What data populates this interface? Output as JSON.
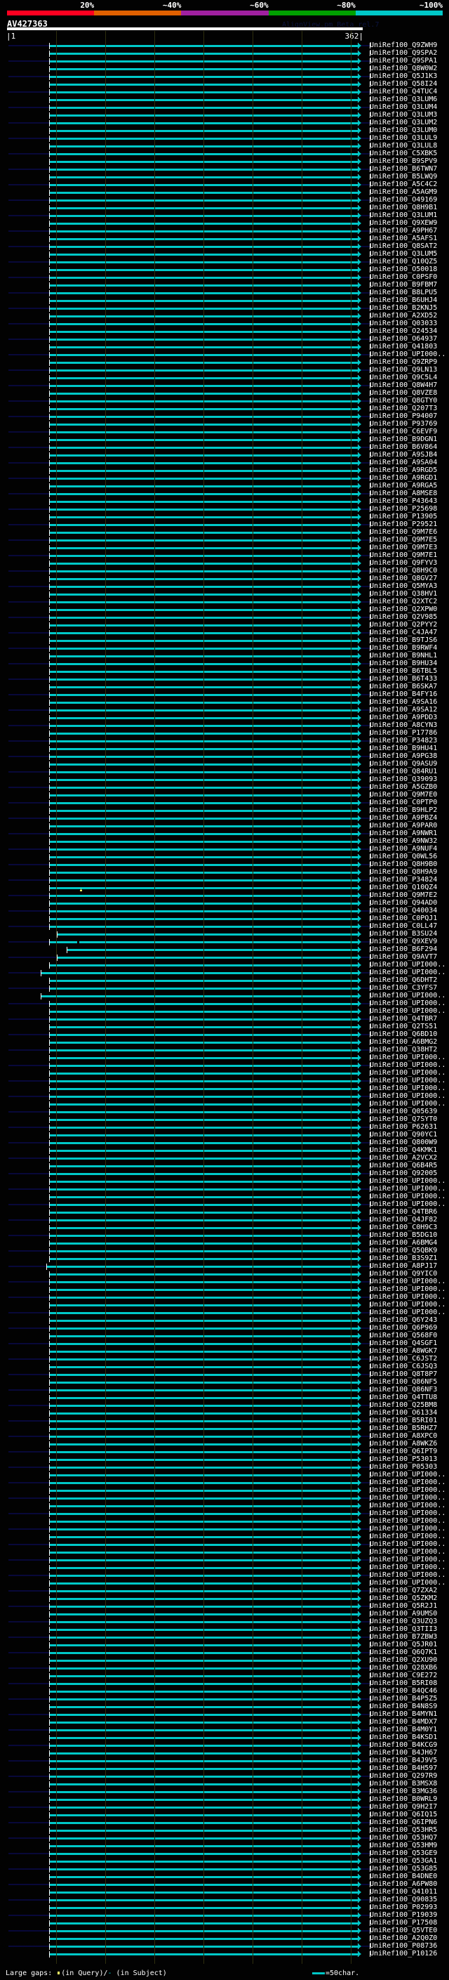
{
  "legend": {
    "percent_labels": [
      "20%",
      "~40%",
      "~60%",
      "~80%",
      "~100%"
    ],
    "colors": [
      "#ff0020",
      "#e06000",
      "#a020a0",
      "#00a000",
      "#00c8c8"
    ]
  },
  "header": {
    "title": "AV427363",
    "watermark": "AlignView.pm Beta rel.7"
  },
  "ruler": {
    "start_label": "|1",
    "end_label": "362|",
    "query_length": 362
  },
  "hit_color": "#00c8c8",
  "hits": [
    [
      "UniRef100_Q9ZWH9",
      43,
      357
    ],
    [
      "UniRef100_Q9SPA2",
      43,
      357
    ],
    [
      "UniRef100_Q9SPA1",
      43,
      357
    ],
    [
      "UniRef100_Q8W0W2",
      43,
      357
    ],
    [
      "UniRef100_Q5J1K3",
      43,
      357
    ],
    [
      "UniRef100_Q58I24",
      43,
      357
    ],
    [
      "UniRef100_Q4TUC4",
      43,
      357
    ],
    [
      "UniRef100_Q3LUM6",
      43,
      357
    ],
    [
      "UniRef100_Q3LUM4",
      43,
      357
    ],
    [
      "UniRef100_Q3LUM3",
      43,
      357
    ],
    [
      "UniRef100_Q3LUM2",
      43,
      357
    ],
    [
      "UniRef100_Q3LUM0",
      43,
      357
    ],
    [
      "UniRef100_Q3LUL9",
      43,
      357
    ],
    [
      "UniRef100_Q3LUL8",
      43,
      357
    ],
    [
      "UniRef100_C5XBK5",
      43,
      357
    ],
    [
      "UniRef100_B9SPV9",
      43,
      357
    ],
    [
      "UniRef100_B6TWN7",
      43,
      357
    ],
    [
      "UniRef100_B5LWQ9",
      43,
      357
    ],
    [
      "UniRef100_A5C4C2",
      43,
      357
    ],
    [
      "UniRef100_A5AGM9",
      43,
      357
    ],
    [
      "UniRef100_O49169",
      43,
      357
    ],
    [
      "UniRef100_Q8H9B1",
      43,
      357
    ],
    [
      "UniRef100_Q3LUM1",
      43,
      357
    ],
    [
      "UniRef100_Q9XEW9",
      43,
      357
    ],
    [
      "UniRef100_A9PH67",
      43,
      357
    ],
    [
      "UniRef100_A5AFS1",
      43,
      357
    ],
    [
      "UniRef100_Q8SAT2",
      43,
      357
    ],
    [
      "UniRef100_Q3LUM5",
      43,
      357
    ],
    [
      "UniRef100_Q10QZ5",
      43,
      357
    ],
    [
      "UniRef100_O50018",
      43,
      357
    ],
    [
      "UniRef100_C0PSF0",
      43,
      357
    ],
    [
      "UniRef100_B9FBM7",
      43,
      357
    ],
    [
      "UniRef100_B8LPU5",
      43,
      357
    ],
    [
      "UniRef100_B6UHJ4",
      43,
      357
    ],
    [
      "UniRef100_B2KNJ5",
      43,
      357
    ],
    [
      "UniRef100_A2XD52",
      43,
      357
    ],
    [
      "UniRef100_Q03033",
      43,
      357
    ],
    [
      "UniRef100_O24534",
      43,
      357
    ],
    [
      "UniRef100_O64937",
      43,
      357
    ],
    [
      "UniRef100_Q41803",
      43,
      357
    ],
    [
      "UniRef100_UPI000..",
      43,
      357
    ],
    [
      "UniRef100_Q9ZRP9",
      43,
      357
    ],
    [
      "UniRef100_Q9LN13",
      43,
      357
    ],
    [
      "UniRef100_Q9C5L4",
      43,
      357
    ],
    [
      "UniRef100_Q8W4H7",
      43,
      357
    ],
    [
      "UniRef100_Q8VZE8",
      43,
      357
    ],
    [
      "UniRef100_Q8GTY0",
      43,
      357
    ],
    [
      "UniRef100_Q207T3",
      43,
      357
    ],
    [
      "UniRef100_P94007",
      43,
      357
    ],
    [
      "UniRef100_P93769",
      43,
      357
    ],
    [
      "UniRef100_C6EVF9",
      43,
      357
    ],
    [
      "UniRef100_B9DGN1",
      43,
      357
    ],
    [
      "UniRef100_B6V864",
      43,
      357
    ],
    [
      "UniRef100_A9SJB4",
      43,
      357
    ],
    [
      "UniRef100_A9SA04",
      43,
      357
    ],
    [
      "UniRef100_A9RGD5",
      43,
      357
    ],
    [
      "UniRef100_A9RGD1",
      43,
      357
    ],
    [
      "UniRef100_A9RGA5",
      43,
      357
    ],
    [
      "UniRef100_A8MSE8",
      43,
      357
    ],
    [
      "UniRef100_P43643",
      43,
      357
    ],
    [
      "UniRef100_P25698",
      43,
      357
    ],
    [
      "UniRef100_P13905",
      43,
      357
    ],
    [
      "UniRef100_P29521",
      43,
      357
    ],
    [
      "UniRef100_Q9M7E6",
      43,
      357
    ],
    [
      "UniRef100_Q9M7E5",
      43,
      357
    ],
    [
      "UniRef100_Q9M7E3",
      43,
      357
    ],
    [
      "UniRef100_Q9M7E1",
      43,
      357
    ],
    [
      "UniRef100_Q9FYV3",
      43,
      357
    ],
    [
      "UniRef100_Q8H9C0",
      43,
      357
    ],
    [
      "UniRef100_Q8GV27",
      43,
      357
    ],
    [
      "UniRef100_Q5MYA3",
      43,
      357
    ],
    [
      "UniRef100_Q38HV1",
      43,
      357
    ],
    [
      "UniRef100_Q2XTC2",
      43,
      357
    ],
    [
      "UniRef100_Q2XPW0",
      43,
      357
    ],
    [
      "UniRef100_Q2V985",
      43,
      357
    ],
    [
      "UniRef100_Q2PYY2",
      43,
      357
    ],
    [
      "UniRef100_C4JA47",
      43,
      357
    ],
    [
      "UniRef100_B9TJS6",
      43,
      357
    ],
    [
      "UniRef100_B9RWF4",
      43,
      357
    ],
    [
      "UniRef100_B9NHL1",
      43,
      357
    ],
    [
      "UniRef100_B9HU34",
      43,
      357
    ],
    [
      "UniRef100_B6TBL5",
      43,
      357
    ],
    [
      "UniRef100_B6T433",
      43,
      357
    ],
    [
      "UniRef100_B6SKA7",
      43,
      357
    ],
    [
      "UniRef100_B4FY16",
      43,
      357
    ],
    [
      "UniRef100_A9SA16",
      43,
      357
    ],
    [
      "UniRef100_A9SA12",
      43,
      357
    ],
    [
      "UniRef100_A9PDD3",
      43,
      357
    ],
    [
      "UniRef100_A8CYN3",
      43,
      357
    ],
    [
      "UniRef100_P17786",
      43,
      357
    ],
    [
      "UniRef100_P34823",
      43,
      357
    ],
    [
      "UniRef100_B9HU41",
      43,
      357
    ],
    [
      "UniRef100_A9PG38",
      43,
      357
    ],
    [
      "UniRef100_Q9ASU9",
      43,
      357
    ],
    [
      "UniRef100_Q84RU1",
      43,
      357
    ],
    [
      "UniRef100_Q39093",
      43,
      357
    ],
    [
      "UniRef100_A5GZB0",
      43,
      357
    ],
    [
      "UniRef100_Q9M7E0",
      43,
      357
    ],
    [
      "UniRef100_C0PTP0",
      43,
      357
    ],
    [
      "UniRef100_B9HLP2",
      43,
      357
    ],
    [
      "UniRef100_A9PBZ4",
      43,
      357
    ],
    [
      "UniRef100_A9PAR0",
      43,
      357
    ],
    [
      "UniRef100_A9NWR1",
      43,
      357
    ],
    [
      "UniRef100_A9NW32",
      43,
      357
    ],
    [
      "UniRef100_A9NUF4",
      43,
      357
    ],
    [
      "UniRef100_Q0WL56",
      43,
      357
    ],
    [
      "UniRef100_Q8H9B0",
      43,
      357
    ],
    [
      "UniRef100_Q8H9A9",
      43,
      357
    ],
    [
      "UniRef100_P34824",
      43,
      357
    ],
    [
      "UniRef100_Q10QZ4",
      43,
      357,
      "qgap",
      75
    ],
    [
      "UniRef100_Q9M7E2",
      43,
      357
    ],
    [
      "UniRef100_Q94AD0",
      43,
      357
    ],
    [
      "UniRef100_Q40034",
      43,
      357
    ],
    [
      "UniRef100_C0PQJ1",
      43,
      357
    ],
    [
      "UniRef100_C0LL47",
      43,
      357
    ],
    [
      "UniRef100_B3SU24",
      51,
      357
    ],
    [
      "UniRef100_Q9XEV9",
      43,
      357,
      "sgap",
      72
    ],
    [
      "UniRef100_B6F294",
      61,
      357
    ],
    [
      "UniRef100_Q9AVT7",
      51,
      357
    ],
    [
      "UniRef100_UPI000..",
      43,
      357
    ],
    [
      "UniRef100_UPI000..",
      34,
      357
    ],
    [
      "UniRef100_Q6DHT2",
      43,
      357
    ],
    [
      "UniRef100_C3YFS7",
      43,
      357
    ],
    [
      "UniRef100_UPI000..",
      34,
      357
    ],
    [
      "UniRef100_UPI000..",
      43,
      357
    ],
    [
      "UniRef100_UPI000..",
      43,
      357
    ],
    [
      "UniRef100_Q4TBR7",
      43,
      357
    ],
    [
      "UniRef100_Q2TS51",
      43,
      357
    ],
    [
      "UniRef100_Q6BD10",
      43,
      357
    ],
    [
      "UniRef100_A6BMG2",
      43,
      357
    ],
    [
      "UniRef100_Q38HT2",
      43,
      357
    ],
    [
      "UniRef100_UPI000..",
      43,
      357
    ],
    [
      "UniRef100_UPI000..",
      43,
      357
    ],
    [
      "UniRef100_UPI000..",
      43,
      357
    ],
    [
      "UniRef100_UPI000..",
      43,
      357
    ],
    [
      "UniRef100_UPI000..",
      43,
      357
    ],
    [
      "UniRef100_UPI000..",
      43,
      357
    ],
    [
      "UniRef100_UPI000..",
      43,
      357
    ],
    [
      "UniRef100_Q05639",
      43,
      357
    ],
    [
      "UniRef100_Q7SYT0",
      43,
      357
    ],
    [
      "UniRef100_P62631",
      43,
      357
    ],
    [
      "UniRef100_Q90YC1",
      43,
      357
    ],
    [
      "UniRef100_Q800W9",
      43,
      357
    ],
    [
      "UniRef100_Q4KMK1",
      43,
      357
    ],
    [
      "UniRef100_A2VCX2",
      43,
      357
    ],
    [
      "UniRef100_Q6B4R5",
      43,
      357
    ],
    [
      "UniRef100_Q92005",
      43,
      357
    ],
    [
      "UniRef100_UPI000..",
      43,
      357
    ],
    [
      "UniRef100_UPI000..",
      43,
      357
    ],
    [
      "UniRef100_UPI000..",
      43,
      357
    ],
    [
      "UniRef100_UPI000..",
      43,
      357
    ],
    [
      "UniRef100_Q4TBR6",
      43,
      357
    ],
    [
      "UniRef100_Q4JF82",
      43,
      357
    ],
    [
      "UniRef100_C0H9C3",
      43,
      357
    ],
    [
      "UniRef100_B5DG10",
      43,
      357
    ],
    [
      "UniRef100_A6BMG4",
      43,
      357
    ],
    [
      "UniRef100_Q5QBK9",
      43,
      357
    ],
    [
      "UniRef100_B3S9Z1",
      43,
      357
    ],
    [
      "UniRef100_A8PJ17",
      40,
      357
    ],
    [
      "UniRef100_Q9YIC0",
      43,
      357
    ],
    [
      "UniRef100_UPI000..",
      43,
      357
    ],
    [
      "UniRef100_UPI000..",
      43,
      357
    ],
    [
      "UniRef100_UPI000..",
      43,
      357
    ],
    [
      "UniRef100_UPI000..",
      43,
      357
    ],
    [
      "UniRef100_UPI000..",
      43,
      357
    ],
    [
      "UniRef100_Q6Y243",
      43,
      357
    ],
    [
      "UniRef100_Q6P969",
      43,
      357
    ],
    [
      "UniRef100_Q568F0",
      43,
      357
    ],
    [
      "UniRef100_Q4SGF1",
      43,
      357
    ],
    [
      "UniRef100_A8WGK7",
      43,
      357
    ],
    [
      "UniRef100_C6JST2",
      43,
      357
    ],
    [
      "UniRef100_C6JSQ3",
      43,
      357
    ],
    [
      "UniRef100_Q8T8P7",
      43,
      357
    ],
    [
      "UniRef100_Q86NF5",
      43,
      357
    ],
    [
      "UniRef100_Q86NF3",
      43,
      357
    ],
    [
      "UniRef100_Q4TTU8",
      43,
      357
    ],
    [
      "UniRef100_Q25BM8",
      43,
      357
    ],
    [
      "UniRef100_O61334",
      43,
      357
    ],
    [
      "UniRef100_B5RI01",
      43,
      357
    ],
    [
      "UniRef100_B5RHZ7",
      43,
      357
    ],
    [
      "UniRef100_A8XPC0",
      43,
      357
    ],
    [
      "UniRef100_A8WKZ6",
      43,
      357
    ],
    [
      "UniRef100_Q6IPT9",
      43,
      357
    ],
    [
      "UniRef100_P53013",
      43,
      357
    ],
    [
      "UniRef100_P05303",
      43,
      357
    ],
    [
      "UniRef100_UPI000..",
      43,
      357
    ],
    [
      "UniRef100_UPI000..",
      43,
      357
    ],
    [
      "UniRef100_UPI000..",
      43,
      357
    ],
    [
      "UniRef100_UPI000..",
      43,
      357
    ],
    [
      "UniRef100_UPI000..",
      43,
      357
    ],
    [
      "UniRef100_UPI000..",
      43,
      357
    ],
    [
      "UniRef100_UPI000..",
      43,
      357
    ],
    [
      "UniRef100_UPI000..",
      43,
      357
    ],
    [
      "UniRef100_UPI000..",
      43,
      357
    ],
    [
      "UniRef100_UPI000..",
      43,
      357
    ],
    [
      "UniRef100_UPI000..",
      43,
      357
    ],
    [
      "UniRef100_UPI000..",
      43,
      357
    ],
    [
      "UniRef100_UPI000..",
      43,
      357
    ],
    [
      "UniRef100_UPI000..",
      43,
      357
    ],
    [
      "UniRef100_UPI000..",
      43,
      357
    ],
    [
      "UniRef100_Q7ZXA2",
      43,
      357
    ],
    [
      "UniRef100_Q5ZKM2",
      43,
      357
    ],
    [
      "UniRef100_Q5R2J1",
      43,
      357
    ],
    [
      "UniRef100_A9UMS0",
      43,
      357
    ],
    [
      "UniRef100_Q3UZQ3",
      43,
      357
    ],
    [
      "UniRef100_Q3TII3",
      43,
      357
    ],
    [
      "UniRef100_B7ZBW3",
      43,
      357
    ],
    [
      "UniRef100_Q5JR01",
      43,
      357
    ],
    [
      "UniRef100_Q6Q7K1",
      43,
      357
    ],
    [
      "UniRef100_Q2XU90",
      43,
      357
    ],
    [
      "UniRef100_Q28XB6",
      43,
      357
    ],
    [
      "UniRef100_C9E272",
      43,
      357
    ],
    [
      "UniRef100_B5RI08",
      43,
      357
    ],
    [
      "UniRef100_B4QC46",
      43,
      357
    ],
    [
      "UniRef100_B4P5Z5",
      43,
      357
    ],
    [
      "UniRef100_B4N8S9",
      43,
      357
    ],
    [
      "UniRef100_B4MYN1",
      43,
      357
    ],
    [
      "UniRef100_B4MDX7",
      43,
      357
    ],
    [
      "UniRef100_B4M0Y1",
      43,
      357
    ],
    [
      "UniRef100_B4KSD1",
      43,
      357
    ],
    [
      "UniRef100_B4KCG9",
      43,
      357
    ],
    [
      "UniRef100_B4JH67",
      43,
      357
    ],
    [
      "UniRef100_B4J9V5",
      43,
      357
    ],
    [
      "UniRef100_B4H597",
      43,
      357
    ],
    [
      "UniRef100_Q297R9",
      43,
      357
    ],
    [
      "UniRef100_B3MSX8",
      43,
      357
    ],
    [
      "UniRef100_B3MG36",
      43,
      357
    ],
    [
      "UniRef100_B0WRL9",
      43,
      357
    ],
    [
      "UniRef100_Q9H2I7",
      43,
      357
    ],
    [
      "UniRef100_Q6IQ15",
      43,
      357
    ],
    [
      "UniRef100_Q6IPN6",
      43,
      357
    ],
    [
      "UniRef100_Q53HR5",
      43,
      357
    ],
    [
      "UniRef100_Q53HQ7",
      43,
      357
    ],
    [
      "UniRef100_Q53HM9",
      43,
      357
    ],
    [
      "UniRef100_Q53GE9",
      43,
      357
    ],
    [
      "UniRef100_Q53GA1",
      43,
      357
    ],
    [
      "UniRef100_Q53G85",
      43,
      357
    ],
    [
      "UniRef100_B4DNE0",
      43,
      357
    ],
    [
      "UniRef100_A6PW80",
      43,
      357
    ],
    [
      "UniRef100_Q41011",
      43,
      357
    ],
    [
      "UniRef100_Q90835",
      43,
      357
    ],
    [
      "UniRef100_P02993",
      43,
      357
    ],
    [
      "UniRef100_P19039",
      43,
      357
    ],
    [
      "UniRef100_P17508",
      43,
      357
    ],
    [
      "UniRef100_Q5VTE0",
      43,
      357
    ],
    [
      "UniRef100_A2Q0Z0",
      43,
      357
    ],
    [
      "UniRef100_P08736",
      43,
      357
    ],
    [
      "UniRef100_P10126",
      43,
      357
    ]
  ],
  "footer": {
    "gaps_label": "Large gaps:",
    "query_gap_text": "(in Query)/",
    "subject_gap_marker": "-",
    "subject_gap_text": " (in Subject)",
    "scale_text": "=50char."
  }
}
